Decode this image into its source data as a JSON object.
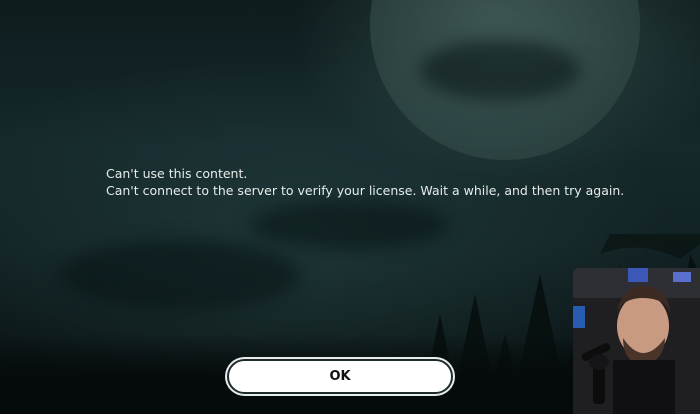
{
  "dialog": {
    "title_line": "Can't use this content.",
    "message_line": "Can't connect to the server to verify your license. Wait a while, and then try again.",
    "ok_label": "OK"
  },
  "webcam_overlay": {
    "description_icon": "person-webcam"
  }
}
